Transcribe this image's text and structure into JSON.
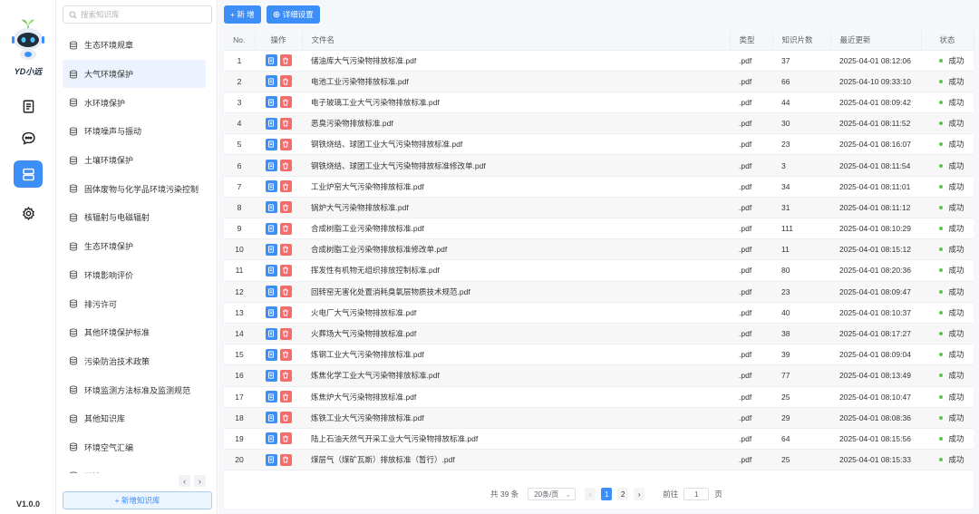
{
  "app": {
    "logo_text": "YD小远",
    "version": "V1.0.0",
    "nav": [
      {
        "icon": "document-icon",
        "active": false
      },
      {
        "icon": "chat-icon",
        "active": false
      },
      {
        "icon": "database-icon",
        "active": true
      },
      {
        "icon": "gear-icon",
        "active": false
      }
    ]
  },
  "sidebar": {
    "search_placeholder": "搜索知识库",
    "add_label": "+ 新增知识库",
    "items": [
      {
        "label": "生态环境规章",
        "active": false
      },
      {
        "label": "大气环境保护",
        "active": true
      },
      {
        "label": "水环境保护",
        "active": false
      },
      {
        "label": "环境噪声与振动",
        "active": false
      },
      {
        "label": "土壤环境保护",
        "active": false
      },
      {
        "label": "固体废物与化学品环境污染控制",
        "active": false
      },
      {
        "label": "核辐射与电磁辐射",
        "active": false
      },
      {
        "label": "生态环境保护",
        "active": false
      },
      {
        "label": "环境影响评价",
        "active": false
      },
      {
        "label": "排污许可",
        "active": false
      },
      {
        "label": "其他环境保护标准",
        "active": false
      },
      {
        "label": "污染防治技术政策",
        "active": false
      },
      {
        "label": "环境监测方法标准及监测规范",
        "active": false
      },
      {
        "label": "其他知识库",
        "active": false
      },
      {
        "label": "环境空气汇编",
        "active": false
      },
      {
        "label": "环境...",
        "active": false
      }
    ]
  },
  "toolbar": {
    "new_label": "+ 新 增",
    "settings_label": "详细设置"
  },
  "table": {
    "columns": [
      "No.",
      "操作",
      "文件名",
      "类型",
      "知识片数",
      "最近更新",
      "状态"
    ],
    "rows": [
      {
        "no": "1",
        "name": "储油库大气污染物排放标准.pdf",
        "type": ".pdf",
        "count": "37",
        "updated": "2025-04-01 08:12:06",
        "status": "成功"
      },
      {
        "no": "2",
        "name": "电池工业污染物排放标准.pdf",
        "type": ".pdf",
        "count": "66",
        "updated": "2025-04-10 09:33:10",
        "status": "成功"
      },
      {
        "no": "3",
        "name": "电子玻璃工业大气污染物排放标准.pdf",
        "type": ".pdf",
        "count": "44",
        "updated": "2025-04-01 08:09:42",
        "status": "成功"
      },
      {
        "no": "4",
        "name": "恶臭污染物排放标准.pdf",
        "type": ".pdf",
        "count": "30",
        "updated": "2025-04-01 08:11:52",
        "status": "成功"
      },
      {
        "no": "5",
        "name": "钢铁烧结、球团工业大气污染物排放标准.pdf",
        "type": ".pdf",
        "count": "23",
        "updated": "2025-04-01 08:16:07",
        "status": "成功"
      },
      {
        "no": "6",
        "name": "钢铁烧结、球团工业大气污染物排放标准修改单.pdf",
        "type": ".pdf",
        "count": "3",
        "updated": "2025-04-01 08:11:54",
        "status": "成功"
      },
      {
        "no": "7",
        "name": "工业炉窑大气污染物排放标准.pdf",
        "type": ".pdf",
        "count": "34",
        "updated": "2025-04-01 08:11:01",
        "status": "成功"
      },
      {
        "no": "8",
        "name": "锅炉大气污染物排放标准.pdf",
        "type": ".pdf",
        "count": "31",
        "updated": "2025-04-01 08:11:12",
        "status": "成功"
      },
      {
        "no": "9",
        "name": "合成树脂工业污染物排放标准.pdf",
        "type": ".pdf",
        "count": "111",
        "updated": "2025-04-01 08:10:29",
        "status": "成功"
      },
      {
        "no": "10",
        "name": "合成树脂工业污染物排放标准修改单.pdf",
        "type": ".pdf",
        "count": "11",
        "updated": "2025-04-01 08:15:12",
        "status": "成功"
      },
      {
        "no": "11",
        "name": "挥发性有机物无组织排放控制标准.pdf",
        "type": ".pdf",
        "count": "80",
        "updated": "2025-04-01 08:20:36",
        "status": "成功"
      },
      {
        "no": "12",
        "name": "回转窑无害化处置消耗臭氧层物质技术规范.pdf",
        "type": ".pdf",
        "count": "23",
        "updated": "2025-04-01 08:09:47",
        "status": "成功"
      },
      {
        "no": "13",
        "name": "火电厂大气污染物排放标准.pdf",
        "type": ".pdf",
        "count": "40",
        "updated": "2025-04-01 08:10:37",
        "status": "成功"
      },
      {
        "no": "14",
        "name": "火葬场大气污染物排放标准.pdf",
        "type": ".pdf",
        "count": "38",
        "updated": "2025-04-01 08:17:27",
        "status": "成功"
      },
      {
        "no": "15",
        "name": "炼钢工业大气污染物排放标准.pdf",
        "type": ".pdf",
        "count": "39",
        "updated": "2025-04-01 08:09:04",
        "status": "成功"
      },
      {
        "no": "16",
        "name": "炼焦化学工业大气污染物排放标准.pdf",
        "type": ".pdf",
        "count": "77",
        "updated": "2025-04-01 08:13:49",
        "status": "成功"
      },
      {
        "no": "17",
        "name": "炼焦炉大气污染物排放标准.pdf",
        "type": ".pdf",
        "count": "25",
        "updated": "2025-04-01 08:10:47",
        "status": "成功"
      },
      {
        "no": "18",
        "name": "炼铁工业大气污染物排放标准.pdf",
        "type": ".pdf",
        "count": "29",
        "updated": "2025-04-01 08:08:36",
        "status": "成功"
      },
      {
        "no": "19",
        "name": "陆上石油天然气开采工业大气污染物排放标准.pdf",
        "type": ".pdf",
        "count": "64",
        "updated": "2025-04-01 08:15:56",
        "status": "成功"
      },
      {
        "no": "20",
        "name": "煤层气（煤矿瓦斯）排放标准（暂行）.pdf",
        "type": ".pdf",
        "count": "25",
        "updated": "2025-04-01 08:15:33",
        "status": "成功"
      }
    ]
  },
  "pagination": {
    "total": "共 39 条",
    "page_size": "20条/页",
    "pages": [
      "1",
      "2"
    ],
    "current": "1",
    "goto_label": "前往",
    "goto_value": "1",
    "page_unit": "页"
  },
  "colors": {
    "accent": "#3e8ef7",
    "danger": "#f56c6c",
    "success": "#5bc34f"
  }
}
